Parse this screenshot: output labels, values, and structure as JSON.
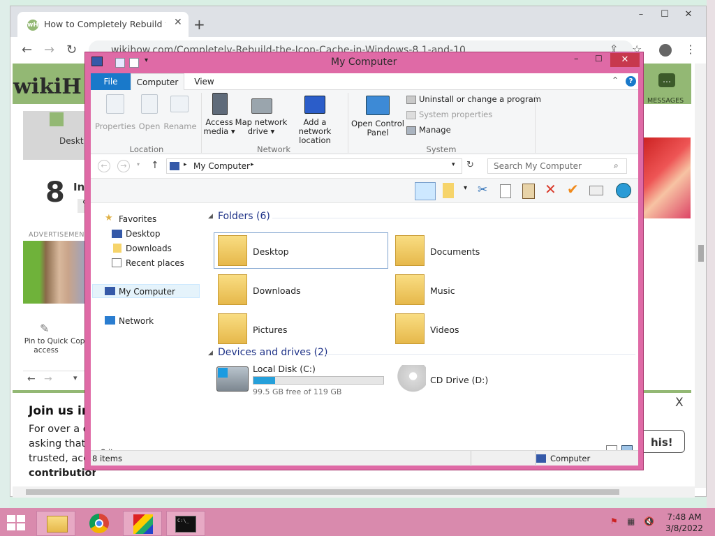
{
  "browser": {
    "tab_title": "How to Completely Rebuild the I",
    "tab_favicon": "wH",
    "url": "wikihow.com/Completely-Rebuild-the-Icon-Cache-in-Windows-8.1-and-10",
    "new_tab": "+",
    "minimize": "–",
    "maximize": "☐",
    "close": "✕"
  },
  "wikihow": {
    "logo": "wikiH",
    "messages_label": "MESSAGES",
    "step_number": "8",
    "step_text": "In",
    "step_chip": "%",
    "partial_item": "Deskt",
    "advertisement": "ADVERTISEMENT",
    "pin_label": "Pin to Quick access",
    "copy_label": "Cop",
    "join_heading": "Join us in",
    "body_lines": [
      "For over a d",
      "asking that y",
      "trusted, accu",
      "contribution"
    ],
    "close_x": "X",
    "cta_button": "his!"
  },
  "explorer": {
    "title": "My Computer",
    "tabs": [
      "File",
      "Computer",
      "View"
    ],
    "ribbon": {
      "location": {
        "label": "Location",
        "buttons": [
          "Properties",
          "Open",
          "Rename"
        ]
      },
      "network": {
        "label": "Network",
        "buttons": [
          {
            "line1": "Access",
            "line2": "media ▾"
          },
          {
            "line1": "Map network",
            "line2": "drive ▾"
          },
          {
            "line1": "Add a network",
            "line2": "location"
          }
        ]
      },
      "system": {
        "label": "System",
        "control_panel_line1": "Open Control",
        "control_panel_line2": "Panel",
        "items": [
          "Uninstall or change a program",
          "System properties",
          "Manage"
        ]
      }
    },
    "address": {
      "path": "My Computer",
      "search_placeholder": "Search My Computer"
    },
    "nav": {
      "favorites": "Favorites",
      "favorites_items": [
        "Desktop",
        "Downloads",
        "Recent places"
      ],
      "my_computer": "My Computer",
      "network": "Network"
    },
    "content": {
      "folders_header": "Folders (6)",
      "folders": [
        "Desktop",
        "Documents",
        "Downloads",
        "Music",
        "Pictures",
        "Videos"
      ],
      "devices_header": "Devices and drives (2)",
      "local_disk": {
        "name": "Local Disk (C:)",
        "free_text": "99.5 GB free of 119 GB",
        "used_fraction": 0.164
      },
      "cd_drive": "CD Drive (D:)"
    },
    "status": {
      "items_inner": "8 items",
      "items_bar": "8 items",
      "location": "Computer"
    }
  },
  "taskbar": {
    "time": "7:48 AM",
    "date": "3/8/2022"
  },
  "colors": {
    "window_frame": "#df6aa6",
    "taskbar": "#d98aad",
    "accent_blue": "#1979ca",
    "wiki_green": "#93b874"
  }
}
